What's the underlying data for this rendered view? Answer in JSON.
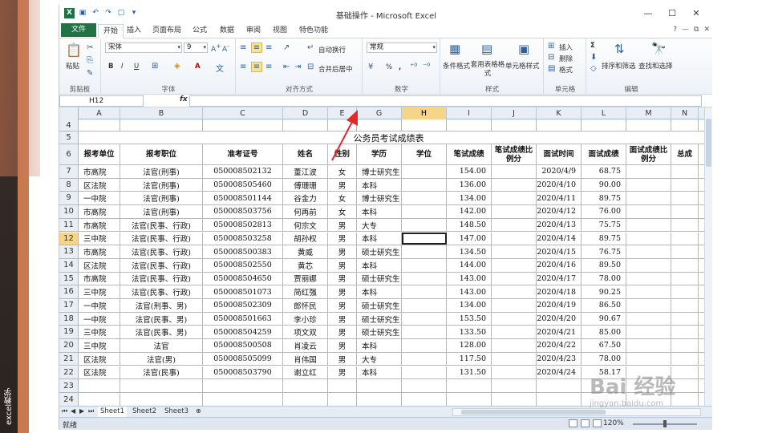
{
  "slide": {
    "side_caption": "excel教学"
  },
  "window": {
    "title": "基础操作 - Microsoft Excel",
    "controls": [
      "—",
      "☐",
      "✕"
    ]
  },
  "tabs": [
    "文件",
    "开始",
    "插入",
    "页面布局",
    "公式",
    "数据",
    "审阅",
    "视图",
    "特色功能"
  ],
  "ribbon": {
    "clipboard": {
      "paste": "粘贴",
      "label": "剪贴板"
    },
    "font": {
      "name": "宋体",
      "size": "9",
      "bold": "B",
      "italic": "I",
      "underline": "U",
      "grow": "A",
      "label": "字体"
    },
    "alignment": {
      "wrap": "自动换行",
      "merge": "合并后居中",
      "label": "对齐方式"
    },
    "number": {
      "format": "常规",
      "percent": "%",
      "comma": ",",
      "label": "数字"
    },
    "styles": {
      "conditional": "条件格式",
      "table": "套用表格格式",
      "cell": "单元格样式",
      "label": "样式"
    },
    "cells": {
      "insert": "插入",
      "delete": "删除",
      "format": "格式",
      "label": "单元格"
    },
    "editing": {
      "sum": "Σ",
      "sort": "排序和筛选",
      "find": "查找和选择",
      "label": "编辑"
    }
  },
  "formula_bar": {
    "name_box": "H12",
    "fx": "fx",
    "value": ""
  },
  "columns": [
    "A",
    "B",
    "C",
    "D",
    "E",
    "G",
    "H",
    "I",
    "J",
    "K",
    "L",
    "M",
    "N"
  ],
  "active_column": "H",
  "active_row": "12",
  "sheet_title": "公务员考试成绩表",
  "headers": [
    "报考单位",
    "报考职位",
    "准考证号",
    "姓名",
    "性别",
    "学历",
    "学位",
    "笔试成绩",
    "笔试成绩比例分",
    "面试时间",
    "面试成绩",
    "面试成绩比例分",
    "总成"
  ],
  "rows": [
    [
      "7",
      "市高院",
      "法官(刑事)",
      "050008502132",
      "董江波",
      "女",
      "博士研究生",
      "",
      "154.00",
      "",
      "2020/4/9",
      "68.75",
      ""
    ],
    [
      "8",
      "区法院",
      "法官(刑事)",
      "050008505460",
      "傅珊珊",
      "男",
      "本科",
      "",
      "136.00",
      "",
      "2020/4/10",
      "90.00",
      ""
    ],
    [
      "9",
      "一中院",
      "法官(刑事)",
      "050008501144",
      "谷金力",
      "女",
      "博士研究生",
      "",
      "134.00",
      "",
      "2020/4/11",
      "89.75",
      ""
    ],
    [
      "10",
      "市高院",
      "法官(刑事)",
      "050008503756",
      "何再前",
      "女",
      "本科",
      "",
      "142.00",
      "",
      "2020/4/12",
      "76.00",
      ""
    ],
    [
      "11",
      "市高院",
      "法官(民事、行政)",
      "050008502813",
      "何宗文",
      "男",
      "大专",
      "",
      "148.50",
      "",
      "2020/4/13",
      "75.75",
      ""
    ],
    [
      "12",
      "三中院",
      "法官(民事、行政)",
      "050008503258",
      "胡孙权",
      "男",
      "本科",
      "",
      "147.00",
      "",
      "2020/4/14",
      "89.75",
      ""
    ],
    [
      "13",
      "市高院",
      "法官(民事、行政)",
      "050008500383",
      "黄威",
      "男",
      "硕士研究生",
      "",
      "134.50",
      "",
      "2020/4/15",
      "76.75",
      ""
    ],
    [
      "14",
      "区法院",
      "法官(民事、行政)",
      "050008502550",
      "黄芯",
      "男",
      "本科",
      "",
      "144.00",
      "",
      "2020/4/16",
      "89.50",
      ""
    ],
    [
      "15",
      "市高院",
      "法官(民事、行政)",
      "050008504650",
      "贾丽娜",
      "男",
      "硕士研究生",
      "",
      "143.00",
      "",
      "2020/4/17",
      "78.00",
      ""
    ],
    [
      "16",
      "三中院",
      "法官(民事、行政)",
      "050008501073",
      "简红强",
      "男",
      "本科",
      "",
      "143.00",
      "",
      "2020/4/18",
      "90.25",
      ""
    ],
    [
      "17",
      "一中院",
      "法官(刑事、男)",
      "050008502309",
      "郎怀民",
      "男",
      "硕士研究生",
      "",
      "134.00",
      "",
      "2020/4/19",
      "86.50",
      ""
    ],
    [
      "18",
      "一中院",
      "法官(民事、男)",
      "050008501663",
      "李小珍",
      "男",
      "硕士研究生",
      "",
      "153.50",
      "",
      "2020/4/20",
      "90.67",
      ""
    ],
    [
      "19",
      "三中院",
      "法官(民事、男)",
      "050008504259",
      "项文双",
      "男",
      "硕士研究生",
      "",
      "133.50",
      "",
      "2020/4/21",
      "85.00",
      ""
    ],
    [
      "20",
      "三中院",
      "法官",
      "050008500508",
      "肖凌云",
      "男",
      "本科",
      "",
      "128.00",
      "",
      "2020/4/22",
      "67.50",
      ""
    ],
    [
      "21",
      "区法院",
      "法官(男)",
      "050008505099",
      "肖伟国",
      "男",
      "大专",
      "",
      "117.50",
      "",
      "2020/4/23",
      "78.00",
      ""
    ],
    [
      "22",
      "区法院",
      "法官(民事)",
      "050008503790",
      "谢立红",
      "男",
      "本科",
      "",
      "131.50",
      "",
      "2020/4/24",
      "58.17",
      ""
    ]
  ],
  "empty_rows": [
    "23",
    "24"
  ],
  "top_rows": [
    "4",
    "5",
    "6"
  ],
  "sheets": [
    "Sheet1",
    "Sheet2",
    "Sheet3"
  ],
  "status": {
    "ready": "就绪",
    "zoom": "120%",
    "zoom_level": 0.5
  },
  "watermark": {
    "logo": "Bai 经验",
    "url": "jingyan.baidu.com"
  },
  "colors": {
    "file_tab": "#217346",
    "selection": "#f5d58a",
    "annotation_arrow": "#e02b2b"
  }
}
